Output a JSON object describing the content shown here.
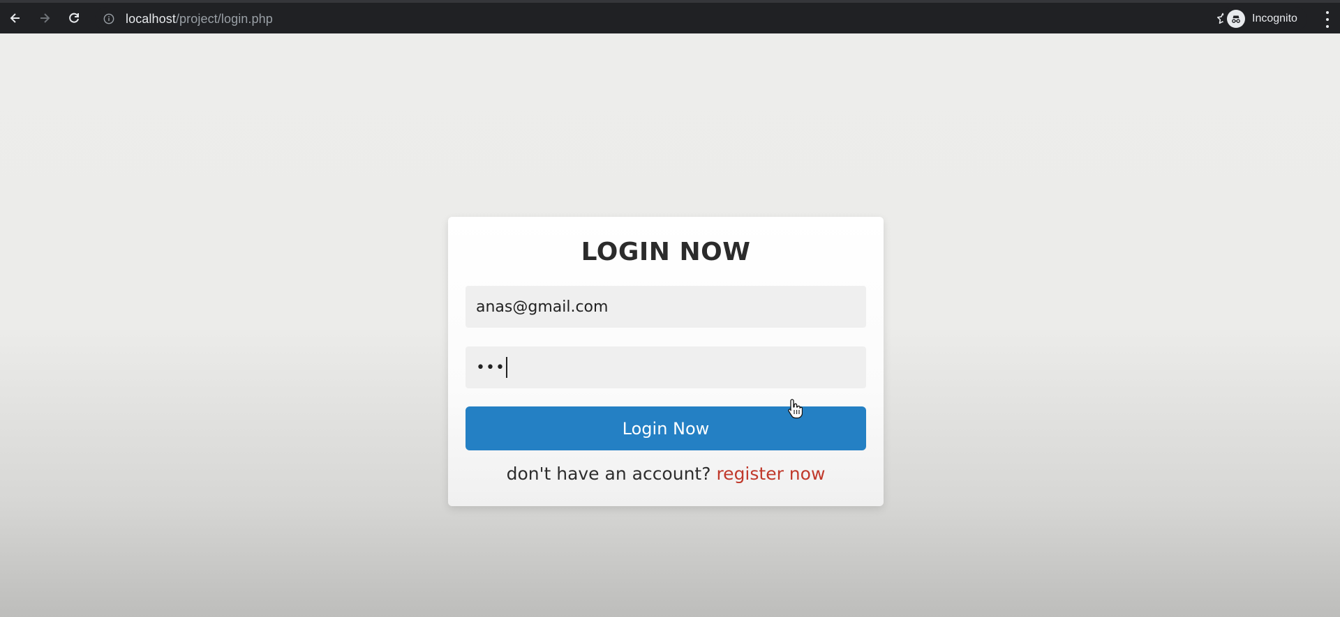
{
  "browser": {
    "url_host": "localhost",
    "url_path": "/project/login.php",
    "incognito_label": "Incognito",
    "icons": {
      "back": "back-arrow-icon",
      "forward": "forward-arrow-icon",
      "reload": "reload-icon",
      "info": "info-icon",
      "star": "star-icon",
      "incognito": "incognito-icon",
      "menu": "kebab-menu-icon"
    }
  },
  "form": {
    "title": "LOGIN NOW",
    "email_value": "anas@gmail.com",
    "password_masked": "•••",
    "submit_label": "Login Now",
    "register_prompt": "don't have an account?",
    "register_link": "register now"
  },
  "colors": {
    "button": "#2480c4",
    "link": "#c0392b",
    "chrome": "#202124"
  }
}
